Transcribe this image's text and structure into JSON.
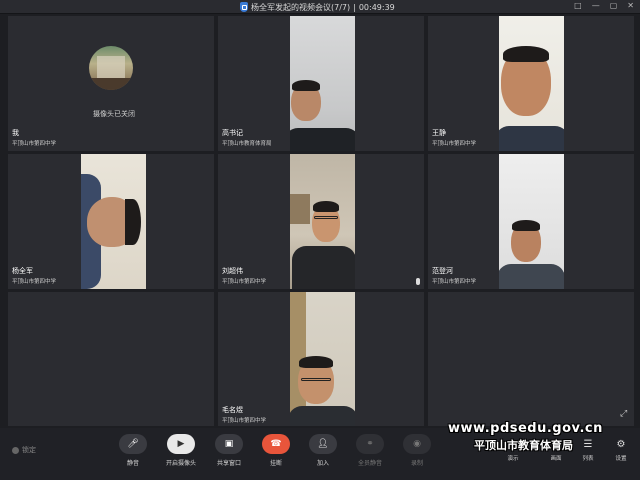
{
  "window": {
    "title": "杨全军发起的视频会议(7/7)",
    "separator": "|",
    "timer": "00:49:39",
    "controls": [
      "□",
      "—",
      "▢",
      "✕"
    ]
  },
  "participants": [
    {
      "name": "我",
      "org": "平顶山市第四中学",
      "camera_status": "摄像头已关闭"
    },
    {
      "name": "高书记",
      "org": "平顶山市教育体育局"
    },
    {
      "name": "王静",
      "org": "平顶山市第四中学"
    },
    {
      "name": "杨全军",
      "org": "平顶山市第四中学"
    },
    {
      "name": "刘超伟",
      "org": "平顶山市第四中学"
    },
    {
      "name": "范登河",
      "org": "平顶山市第四中学"
    },
    {
      "name": "毛名煜",
      "org": "平顶山市第四中学"
    }
  ],
  "toolbar": {
    "lock_label": "锁定",
    "mute": "静音",
    "camera": "开启摄像头",
    "share": "共享窗口",
    "hangup": "挂断",
    "join": "加入",
    "mute_all": "全员静音",
    "record": "录制",
    "right": [
      "演示",
      "画面",
      "列表",
      "设置"
    ]
  },
  "watermark": {
    "url": "www.pdsedu.gov.cn",
    "org": "平顶山市教育体育局"
  },
  "colors": {
    "background": "#1d1e22",
    "tile": "#2b2c31",
    "hangup": "#e8553b",
    "accent": "#3a7bd5"
  }
}
